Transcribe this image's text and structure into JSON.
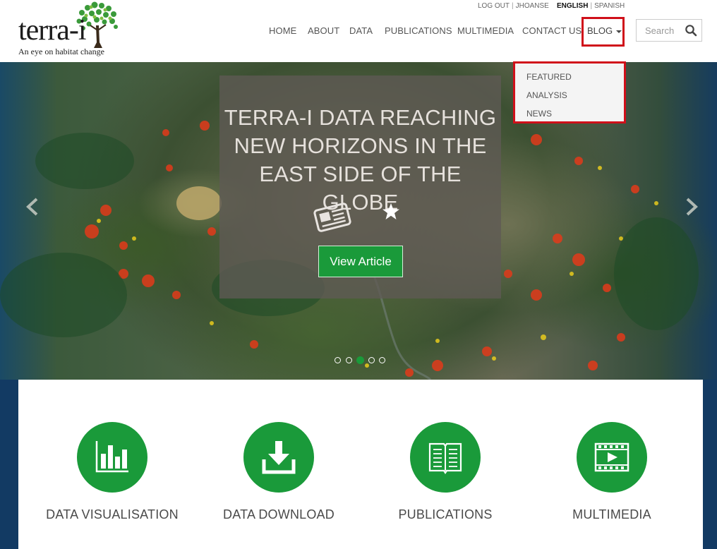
{
  "brand": {
    "name": "terra-i",
    "tagline": "An eye on habitat change"
  },
  "topbar": {
    "logout": "LOG OUT",
    "username": "JHOANSE",
    "separator": "|",
    "lang_english": "ENGLISH",
    "lang_spanish": "SPANISH"
  },
  "nav": {
    "items": [
      "HOME",
      "ABOUT",
      "DATA",
      "PUBLICATIONS",
      "MULTIMEDIA",
      "CONTACT US"
    ],
    "blog": "BLOG"
  },
  "search": {
    "placeholder": "Search",
    "icon": "search-icon"
  },
  "dropdown": {
    "items": [
      "FEATURED",
      "ANALYSIS",
      "NEWS"
    ]
  },
  "hero": {
    "title_lines": [
      "TERRA-I DATA REACHING",
      "NEW HORIZONS IN THE",
      "EAST SIDE OF THE GLOBE"
    ],
    "button": "View Article",
    "icons": [
      "newspaper-icon",
      "star-icon"
    ],
    "slide_count": 5,
    "active_slide": 3
  },
  "features": [
    {
      "label": "DATA VISUALISATION",
      "icon": "bar-chart-icon"
    },
    {
      "label": "DATA DOWNLOAD",
      "icon": "download-icon"
    },
    {
      "label": "PUBLICATIONS",
      "icon": "book-icon"
    },
    {
      "label": "MULTIMEDIA",
      "icon": "film-icon"
    }
  ],
  "colors": {
    "accent_green": "#1a9a3a",
    "highlight_red": "#d0101a"
  }
}
